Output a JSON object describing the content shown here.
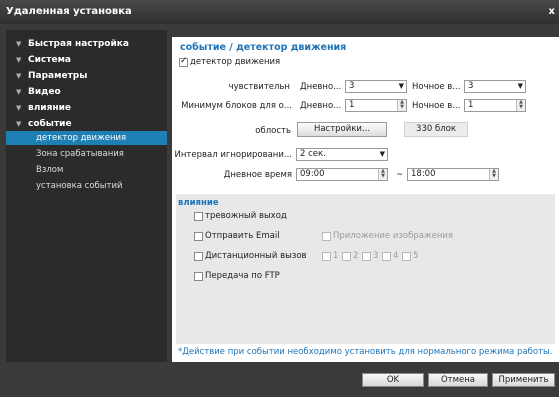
{
  "window": {
    "title": "Удаленная установка",
    "close_label": "x"
  },
  "sidebar": {
    "items": [
      {
        "label": "Быстрая настройка"
      },
      {
        "label": "Система"
      },
      {
        "label": "Параметры"
      },
      {
        "label": "Видео"
      },
      {
        "label": "влияние"
      },
      {
        "label": "событие"
      }
    ],
    "subitems": [
      {
        "label": "детектор движения",
        "active": true
      },
      {
        "label": "Зона срабатывания"
      },
      {
        "label": "Взлом"
      },
      {
        "label": "установка событий"
      }
    ]
  },
  "section": {
    "title": "событие / детектор движения",
    "enable_label": "детектор движения",
    "sensitivity_label": "чувствительн",
    "day_label": "Дневно...",
    "night_label": "Ночное в...",
    "night_label2": "Ночное в...",
    "sensitivity_day": "3",
    "sensitivity_night": "3",
    "min_blocks_label": "Минимум блоков для о...",
    "min_blocks_day": "1",
    "min_blocks_night": "1",
    "area_label": "облость",
    "settings_button": "Настройки...",
    "blocks_count": "330 блок",
    "ignore_label": "Интервал игнорировани...",
    "ignore_value": "2 сек.",
    "daytime_label": "Дневное время",
    "daytime_from": "09:00",
    "daytime_sep": "~",
    "daytime_to": "18:00"
  },
  "action": {
    "title": "влияние",
    "alarm_out": "тревожный выход",
    "send_email": "Отправить Email",
    "attach_image": "Приложение изображения",
    "remote_call": "Дистанционный вызов",
    "remote_nums": [
      "1",
      "2",
      "3",
      "4",
      "5"
    ],
    "ftp": "Передача по FTP"
  },
  "footnote": "*Действие при событии необходимо установить для нормального режима работы.",
  "buttons": {
    "ok": "OK",
    "cancel": "Отмена",
    "apply": "Применить"
  }
}
